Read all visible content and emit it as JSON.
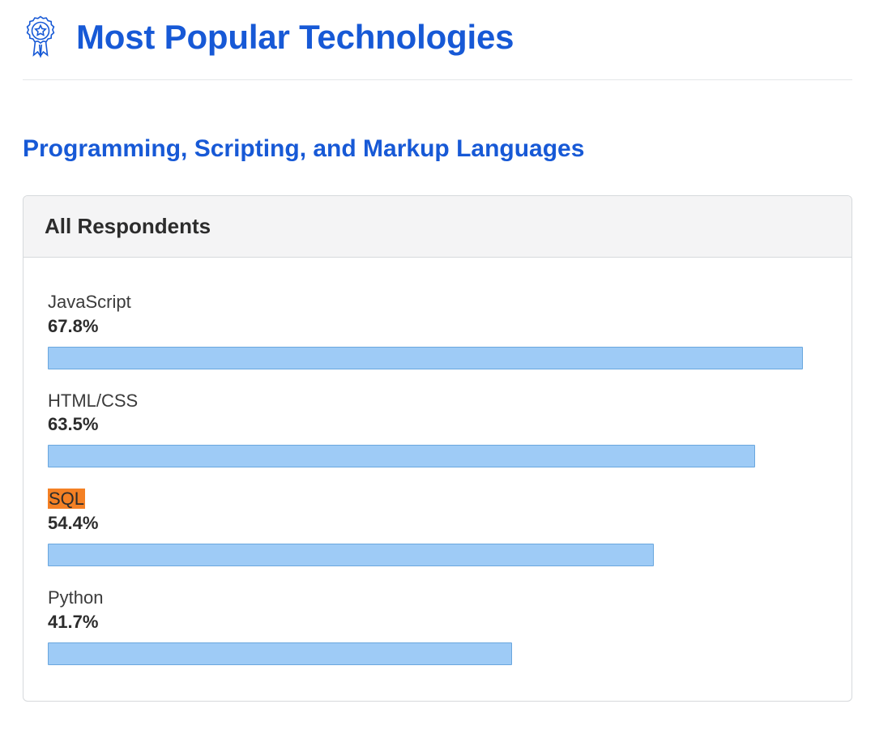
{
  "header": {
    "title": "Most Popular Technologies"
  },
  "subheading": "Programming, Scripting, and Markup Languages",
  "panel": {
    "title": "All Respondents"
  },
  "chart_data": {
    "type": "bar",
    "title": "Programming, Scripting, and Markup Languages — All Respondents",
    "xlabel": "",
    "ylabel": "",
    "max_scale": 70.0,
    "categories": [
      "JavaScript",
      "HTML/CSS",
      "SQL",
      "Python"
    ],
    "values": [
      67.8,
      63.5,
      54.4,
      41.7
    ],
    "value_labels": [
      "67.8%",
      "63.5%",
      "54.4%",
      "41.7%"
    ],
    "highlighted": [
      false,
      false,
      true,
      false
    ]
  },
  "colors": {
    "brand_blue": "#1759d6",
    "bar_fill": "#9ecbf6",
    "bar_border": "#6aa7de",
    "highlight": "#f48024"
  }
}
